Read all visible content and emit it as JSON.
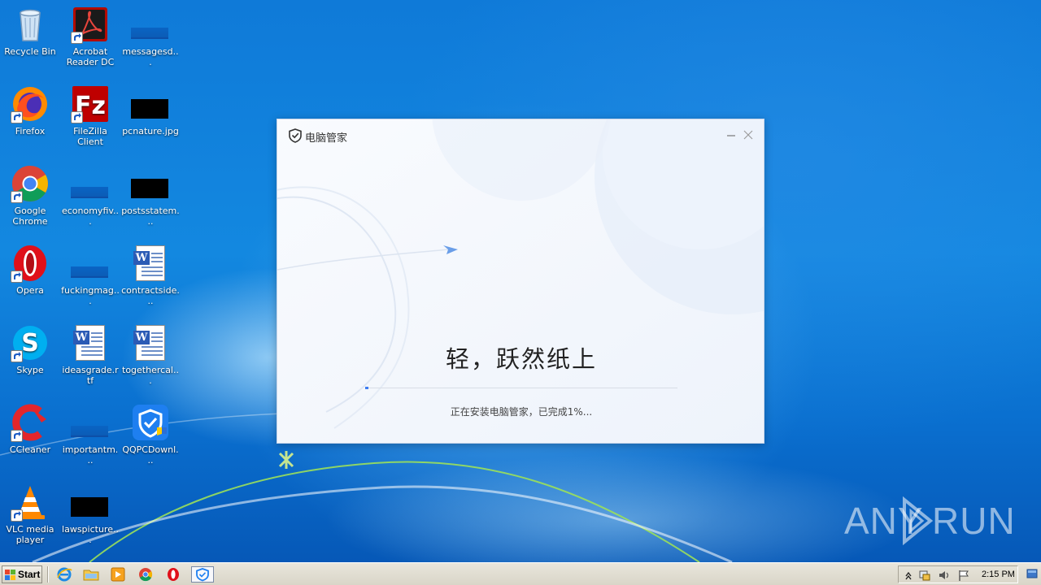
{
  "desktop": {
    "icons": [
      {
        "label": "Recycle Bin",
        "icon": "recycle-bin-icon"
      },
      {
        "label": "Acrobat Reader DC",
        "icon": "acrobat-reader-icon"
      },
      {
        "label": "messagesd...",
        "icon": "blue-image-file-icon"
      },
      {
        "label": "Firefox",
        "icon": "firefox-icon"
      },
      {
        "label": "FileZilla Client",
        "icon": "filezilla-icon"
      },
      {
        "label": "pcnature.jpg",
        "icon": "black-image-file-icon"
      },
      {
        "label": "Google Chrome",
        "icon": "chrome-icon"
      },
      {
        "label": "economyfiv...",
        "icon": "blue-image-file-icon"
      },
      {
        "label": "postsstatem...",
        "icon": "black-image-file-icon"
      },
      {
        "label": "Opera",
        "icon": "opera-icon"
      },
      {
        "label": "fuckingmag...",
        "icon": "blue-image-file-icon"
      },
      {
        "label": "contractside...",
        "icon": "word-document-icon"
      },
      {
        "label": "Skype",
        "icon": "skype-icon"
      },
      {
        "label": "ideasgrade.rtf",
        "icon": "word-document-icon"
      },
      {
        "label": "togethercal...",
        "icon": "word-document-icon"
      },
      {
        "label": "CCleaner",
        "icon": "ccleaner-icon"
      },
      {
        "label": "importantm...",
        "icon": "blue-image-file-icon"
      },
      {
        "label": "QQPCDownl...",
        "icon": "qqpc-installer-icon"
      },
      {
        "label": "VLC media player",
        "icon": "vlc-icon"
      },
      {
        "label": "lawspicture...",
        "icon": "black-image-file-icon"
      }
    ]
  },
  "installer": {
    "title": "电脑管家",
    "slogan": "轻，跃然纸上",
    "status": "正在安装电脑管家，已完成1%...",
    "progress_percent": 1,
    "accent_color": "#3d7cf0"
  },
  "taskbar": {
    "start_label": "Start",
    "pinned": [
      "internet-explorer-icon",
      "folder-icon",
      "media-player-icon",
      "chrome-icon",
      "opera-icon",
      "qqpc-installer-icon"
    ],
    "clock": "2:15 PM"
  },
  "watermark": {
    "left": "ANY",
    "right": "RUN"
  }
}
